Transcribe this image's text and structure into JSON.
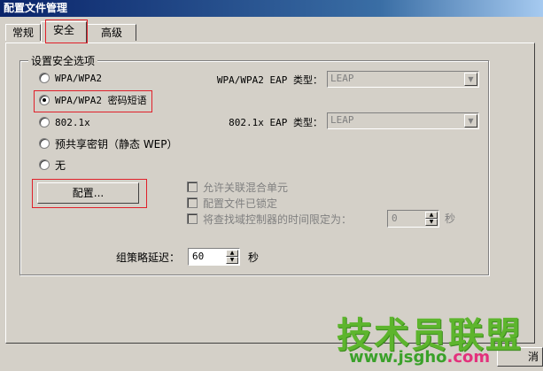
{
  "window": {
    "title": "配置文件管理"
  },
  "tabs": [
    {
      "label": "常规",
      "active": false
    },
    {
      "label": "安全",
      "active": true
    },
    {
      "label": "高级",
      "active": false
    }
  ],
  "group": {
    "title": "设置安全选项"
  },
  "radios": [
    {
      "label": "WPA/WPA2",
      "checked": false
    },
    {
      "label": "WPA/WPA2 密码短语",
      "checked": true
    },
    {
      "label": "802.1x",
      "checked": false
    },
    {
      "label": "预共享密钥（静态 WEP）",
      "checked": false
    },
    {
      "label": "无",
      "checked": false
    }
  ],
  "wpa_eap": {
    "label": "WPA/WPA2 EAP 类型：",
    "value": "LEAP"
  },
  "dot1x_eap": {
    "label": "802.1x EAP 类型：",
    "value": "LEAP"
  },
  "config_button": {
    "label": "配置..."
  },
  "checkboxes": [
    {
      "label": "允许关联混合单元",
      "checked": false
    },
    {
      "label": "配置文件已锁定",
      "checked": false
    },
    {
      "label": "将查找域控制器的时间限定为：",
      "checked": false
    }
  ],
  "timeout": {
    "value": "0",
    "unit": "秒"
  },
  "policy_delay": {
    "label": "组策略延迟：",
    "value": "60",
    "unit": "秒"
  },
  "bottom_button": {
    "label": "消"
  },
  "watermark": {
    "title": "技术员联盟",
    "url_main": "www.jsgho",
    "url_tld": ".com"
  },
  "colors": {
    "highlight_border": "#e0202a",
    "titlebar": "#0a246a",
    "face": "#d4d0c8"
  }
}
